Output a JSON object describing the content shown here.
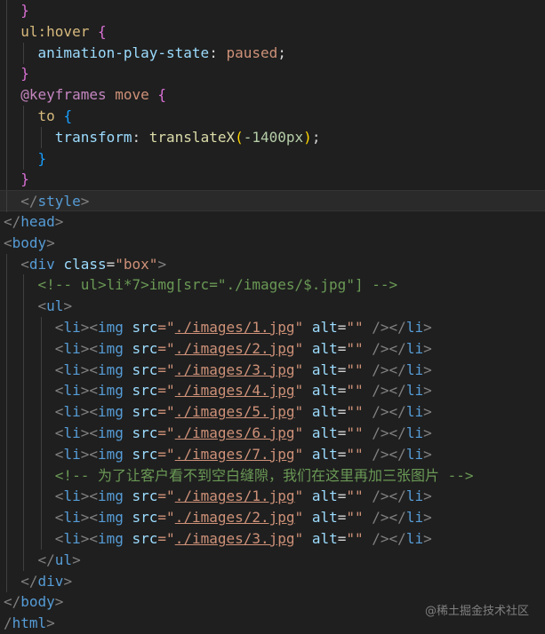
{
  "editor": {
    "language": "html",
    "lines": [
      [
        [
          "  ",
          "plain"
        ],
        [
          "}",
          "b2"
        ]
      ],
      [
        [
          "  ul:hover ",
          "sel"
        ],
        [
          "{",
          "b2"
        ]
      ],
      [
        [
          "    animation-play-state",
          "prop"
        ],
        [
          ": ",
          "plain"
        ],
        [
          "paused",
          "str"
        ],
        [
          ";",
          "plain"
        ]
      ],
      [
        [
          "  ",
          "plain"
        ],
        [
          "}",
          "b2"
        ]
      ],
      [
        [
          "  ",
          "plain"
        ],
        [
          "@keyframes",
          "kw"
        ],
        [
          " move ",
          "str"
        ],
        [
          "{",
          "b2"
        ]
      ],
      [
        [
          "    to ",
          "sel"
        ],
        [
          "{",
          "b3"
        ]
      ],
      [
        [
          "      transform",
          "prop"
        ],
        [
          ": ",
          "plain"
        ],
        [
          "translateX",
          "fn"
        ],
        [
          "(",
          "b1"
        ],
        [
          "-1400px",
          "num"
        ],
        [
          ")",
          "b1"
        ],
        [
          ";",
          "plain"
        ]
      ],
      [
        [
          "    ",
          "plain"
        ],
        [
          "}",
          "b3"
        ]
      ],
      [
        [
          "  ",
          "plain"
        ],
        [
          "}",
          "b2"
        ]
      ],
      [
        [
          "  </",
          "punct"
        ],
        [
          "style",
          "tag"
        ],
        [
          ">",
          "punct"
        ]
      ],
      [
        [
          "</",
          "punct"
        ],
        [
          "head",
          "tag"
        ],
        [
          ">",
          "punct"
        ]
      ],
      [
        [
          "<",
          "punct"
        ],
        [
          "body",
          "tag"
        ],
        [
          ">",
          "punct"
        ]
      ],
      [
        [
          "  <",
          "punct"
        ],
        [
          "div",
          "tag"
        ],
        [
          " ",
          "plain"
        ],
        [
          "class",
          "attr"
        ],
        [
          "=",
          "plain"
        ],
        [
          "\"box\"",
          "str"
        ],
        [
          ">",
          "punct"
        ]
      ],
      [
        [
          "    <!-- ul>li*7>img[src=\"./images/$.jpg\"] -->",
          "cmt"
        ]
      ],
      [
        [
          "    <",
          "punct"
        ],
        [
          "ul",
          "tag"
        ],
        [
          ">",
          "punct"
        ]
      ],
      [
        [
          "      <",
          "punct"
        ],
        [
          "li",
          "tag"
        ],
        [
          "><",
          "punct"
        ],
        [
          "img",
          "tag"
        ],
        [
          " ",
          "plain"
        ],
        [
          "src",
          "attr"
        ],
        [
          "=\"",
          "str"
        ],
        [
          "./images/1.jpg",
          "link"
        ],
        [
          "\"",
          "str"
        ],
        [
          " ",
          "plain"
        ],
        [
          "alt",
          "attr"
        ],
        [
          "=",
          "plain"
        ],
        [
          "\"\"",
          "str"
        ],
        [
          " /></",
          "punct"
        ],
        [
          "li",
          "tag"
        ],
        [
          ">",
          "punct"
        ]
      ],
      [
        [
          "      <",
          "punct"
        ],
        [
          "li",
          "tag"
        ],
        [
          "><",
          "punct"
        ],
        [
          "img",
          "tag"
        ],
        [
          " ",
          "plain"
        ],
        [
          "src",
          "attr"
        ],
        [
          "=\"",
          "str"
        ],
        [
          "./images/2.jpg",
          "link"
        ],
        [
          "\"",
          "str"
        ],
        [
          " ",
          "plain"
        ],
        [
          "alt",
          "attr"
        ],
        [
          "=",
          "plain"
        ],
        [
          "\"\"",
          "str"
        ],
        [
          " /></",
          "punct"
        ],
        [
          "li",
          "tag"
        ],
        [
          ">",
          "punct"
        ]
      ],
      [
        [
          "      <",
          "punct"
        ],
        [
          "li",
          "tag"
        ],
        [
          "><",
          "punct"
        ],
        [
          "img",
          "tag"
        ],
        [
          " ",
          "plain"
        ],
        [
          "src",
          "attr"
        ],
        [
          "=\"",
          "str"
        ],
        [
          "./images/3.jpg",
          "link"
        ],
        [
          "\"",
          "str"
        ],
        [
          " ",
          "plain"
        ],
        [
          "alt",
          "attr"
        ],
        [
          "=",
          "plain"
        ],
        [
          "\"\"",
          "str"
        ],
        [
          " /></",
          "punct"
        ],
        [
          "li",
          "tag"
        ],
        [
          ">",
          "punct"
        ]
      ],
      [
        [
          "      <",
          "punct"
        ],
        [
          "li",
          "tag"
        ],
        [
          "><",
          "punct"
        ],
        [
          "img",
          "tag"
        ],
        [
          " ",
          "plain"
        ],
        [
          "src",
          "attr"
        ],
        [
          "=\"",
          "str"
        ],
        [
          "./images/4.jpg",
          "link"
        ],
        [
          "\"",
          "str"
        ],
        [
          " ",
          "plain"
        ],
        [
          "alt",
          "attr"
        ],
        [
          "=",
          "plain"
        ],
        [
          "\"\"",
          "str"
        ],
        [
          " /></",
          "punct"
        ],
        [
          "li",
          "tag"
        ],
        [
          ">",
          "punct"
        ]
      ],
      [
        [
          "      <",
          "punct"
        ],
        [
          "li",
          "tag"
        ],
        [
          "><",
          "punct"
        ],
        [
          "img",
          "tag"
        ],
        [
          " ",
          "plain"
        ],
        [
          "src",
          "attr"
        ],
        [
          "=\"",
          "str"
        ],
        [
          "./images/5.jpg",
          "link"
        ],
        [
          "\"",
          "str"
        ],
        [
          " ",
          "plain"
        ],
        [
          "alt",
          "attr"
        ],
        [
          "=",
          "plain"
        ],
        [
          "\"\"",
          "str"
        ],
        [
          " /></",
          "punct"
        ],
        [
          "li",
          "tag"
        ],
        [
          ">",
          "punct"
        ]
      ],
      [
        [
          "      <",
          "punct"
        ],
        [
          "li",
          "tag"
        ],
        [
          "><",
          "punct"
        ],
        [
          "img",
          "tag"
        ],
        [
          " ",
          "plain"
        ],
        [
          "src",
          "attr"
        ],
        [
          "=\"",
          "str"
        ],
        [
          "./images/6.jpg",
          "link"
        ],
        [
          "\"",
          "str"
        ],
        [
          " ",
          "plain"
        ],
        [
          "alt",
          "attr"
        ],
        [
          "=",
          "plain"
        ],
        [
          "\"\"",
          "str"
        ],
        [
          " /></",
          "punct"
        ],
        [
          "li",
          "tag"
        ],
        [
          ">",
          "punct"
        ]
      ],
      [
        [
          "      <",
          "punct"
        ],
        [
          "li",
          "tag"
        ],
        [
          "><",
          "punct"
        ],
        [
          "img",
          "tag"
        ],
        [
          " ",
          "plain"
        ],
        [
          "src",
          "attr"
        ],
        [
          "=\"",
          "str"
        ],
        [
          "./images/7.jpg",
          "link"
        ],
        [
          "\"",
          "str"
        ],
        [
          " ",
          "plain"
        ],
        [
          "alt",
          "attr"
        ],
        [
          "=",
          "plain"
        ],
        [
          "\"\"",
          "str"
        ],
        [
          " /></",
          "punct"
        ],
        [
          "li",
          "tag"
        ],
        [
          ">",
          "punct"
        ]
      ],
      [
        [
          "      <!-- 为了让客户看不到空白缝隙，我们在这里再加三张图片 -->",
          "cmt"
        ]
      ],
      [
        [
          "      <",
          "punct"
        ],
        [
          "li",
          "tag"
        ],
        [
          "><",
          "punct"
        ],
        [
          "img",
          "tag"
        ],
        [
          " ",
          "plain"
        ],
        [
          "src",
          "attr"
        ],
        [
          "=\"",
          "str"
        ],
        [
          "./images/1.jpg",
          "link"
        ],
        [
          "\"",
          "str"
        ],
        [
          " ",
          "plain"
        ],
        [
          "alt",
          "attr"
        ],
        [
          "=",
          "plain"
        ],
        [
          "\"\"",
          "str"
        ],
        [
          " /></",
          "punct"
        ],
        [
          "li",
          "tag"
        ],
        [
          ">",
          "punct"
        ]
      ],
      [
        [
          "      <",
          "punct"
        ],
        [
          "li",
          "tag"
        ],
        [
          "><",
          "punct"
        ],
        [
          "img",
          "tag"
        ],
        [
          " ",
          "plain"
        ],
        [
          "src",
          "attr"
        ],
        [
          "=\"",
          "str"
        ],
        [
          "./images/2.jpg",
          "link"
        ],
        [
          "\"",
          "str"
        ],
        [
          " ",
          "plain"
        ],
        [
          "alt",
          "attr"
        ],
        [
          "=",
          "plain"
        ],
        [
          "\"\"",
          "str"
        ],
        [
          " /></",
          "punct"
        ],
        [
          "li",
          "tag"
        ],
        [
          ">",
          "punct"
        ]
      ],
      [
        [
          "      <",
          "punct"
        ],
        [
          "li",
          "tag"
        ],
        [
          "><",
          "punct"
        ],
        [
          "img",
          "tag"
        ],
        [
          " ",
          "plain"
        ],
        [
          "src",
          "attr"
        ],
        [
          "=\"",
          "str"
        ],
        [
          "./images/3.jpg",
          "link"
        ],
        [
          "\"",
          "str"
        ],
        [
          " ",
          "plain"
        ],
        [
          "alt",
          "attr"
        ],
        [
          "=",
          "plain"
        ],
        [
          "\"\"",
          "str"
        ],
        [
          " /></",
          "punct"
        ],
        [
          "li",
          "tag"
        ],
        [
          ">",
          "punct"
        ]
      ],
      [
        [
          "    </",
          "punct"
        ],
        [
          "ul",
          "tag"
        ],
        [
          ">",
          "punct"
        ]
      ],
      [
        [
          "  </",
          "punct"
        ],
        [
          "div",
          "tag"
        ],
        [
          ">",
          "punct"
        ]
      ],
      [
        [
          "</",
          "punct"
        ],
        [
          "body",
          "tag"
        ],
        [
          ">",
          "punct"
        ]
      ],
      [
        [
          "/",
          "punct"
        ],
        [
          "html",
          "tag"
        ],
        [
          ">",
          "punct"
        ]
      ]
    ],
    "active_line": 9
  },
  "watermark": "@稀土掘金技术社区"
}
